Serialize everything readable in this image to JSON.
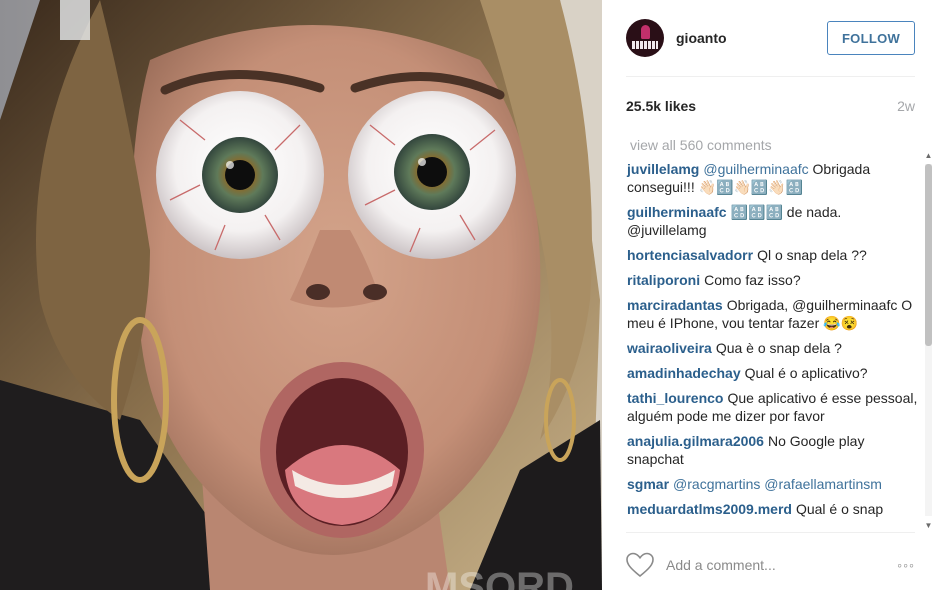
{
  "post": {
    "username": "gioanto",
    "follow_label": "FOLLOW",
    "likes": "25.5k likes",
    "age": "2w",
    "view_all": "view all 560 comments",
    "add_comment_placeholder": "Add a comment...",
    "more_glyph": "◦◦◦",
    "photo_watermark": "MSQRD"
  },
  "comments": [
    {
      "user": "juvillelamg",
      "mention": "@guilherminaafc",
      "text": "Obrigada consegui!!! 👋🏻🔠👋🏻🔠👋🏻🔠"
    },
    {
      "user": "guilherminaafc",
      "mention": "",
      "text": "🔠🔠🔠 de nada. @juvillelamg"
    },
    {
      "user": "hortenciasalvadorr",
      "mention": "",
      "text": "Ql o snap dela ??"
    },
    {
      "user": "ritaliporoni",
      "mention": "",
      "text": "Como faz isso?"
    },
    {
      "user": "marciradantas",
      "mention": "",
      "text": "Obrigada, @guilherminaafc O meu é IPhone, vou tentar fazer 😂😵"
    },
    {
      "user": "wairaoliveira",
      "mention": "",
      "text": "Qua è o snap dela ?"
    },
    {
      "user": "amadinhadechay",
      "mention": "",
      "text": "Qual é o aplicativo?"
    },
    {
      "user": "tathi_lourenco",
      "mention": "",
      "text": "Que aplicativo é esse pessoal, alguém pode me dizer por favor"
    },
    {
      "user": "anajulia.gilmara2006",
      "mention": "",
      "text": "No Google play snapchat"
    },
    {
      "user": "sgmar",
      "mention": "@racgmartins @rafaellamartinsm",
      "text": ""
    },
    {
      "user": "meduardatlms2009.merd",
      "mention": "",
      "text": "Qual é o snap"
    }
  ],
  "icons": {
    "heart": "heart-icon",
    "more": "more-options-icon",
    "scroll_up": "▲",
    "scroll_down": "▼"
  },
  "colors": {
    "username_link": "#2b5f8c",
    "follow_border": "#4a84bd",
    "muted": "#a5a7aa"
  }
}
